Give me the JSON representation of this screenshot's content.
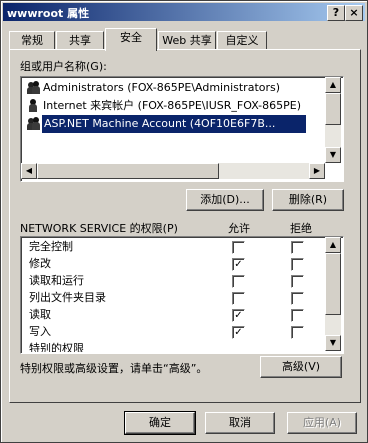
{
  "window": {
    "title": "wwwroot 属性",
    "help_button": "?",
    "close_button": "×"
  },
  "tabs": [
    {
      "label": "常规"
    },
    {
      "label": "共享"
    },
    {
      "label": "安全",
      "active": true
    },
    {
      "label": "Web 共享"
    },
    {
      "label": "自定义"
    }
  ],
  "users": {
    "label": "组或用户名称(G):",
    "items": [
      {
        "name": "Administrators (FOX-865PE\\Administrators)",
        "icon": "user-group-icon"
      },
      {
        "name": "Internet 来宾帐户 (FOX-865PE\\IUSR_FOX-865PE)",
        "icon": "user-icon"
      },
      {
        "name": "ASP.NET Machine Account (4OF10E6F7B...",
        "icon": "user-group-icon",
        "selected": true
      }
    ],
    "add_button": "添加(D)...",
    "remove_button": "删除(R)"
  },
  "permissions": {
    "label": "NETWORK SERVICE 的权限(P)",
    "allow_header": "允许",
    "deny_header": "拒绝",
    "rows": [
      {
        "name": "完全控制",
        "allow": false,
        "deny": false
      },
      {
        "name": "修改",
        "allow": true,
        "deny": false
      },
      {
        "name": "读取和运行",
        "allow": false,
        "deny": false
      },
      {
        "name": "列出文件夹目录",
        "allow": false,
        "deny": false
      },
      {
        "name": "读取",
        "allow": true,
        "deny": false
      },
      {
        "name": "写入",
        "allow": true,
        "deny": false
      },
      {
        "name": "特别的权限",
        "allow": false,
        "deny": false
      }
    ]
  },
  "advanced": {
    "text": "特别权限或高级设置，请单击“高级”。",
    "button": "高级(V)"
  },
  "footer": {
    "ok": "确定",
    "cancel": "取消",
    "apply": "应用(A)"
  }
}
